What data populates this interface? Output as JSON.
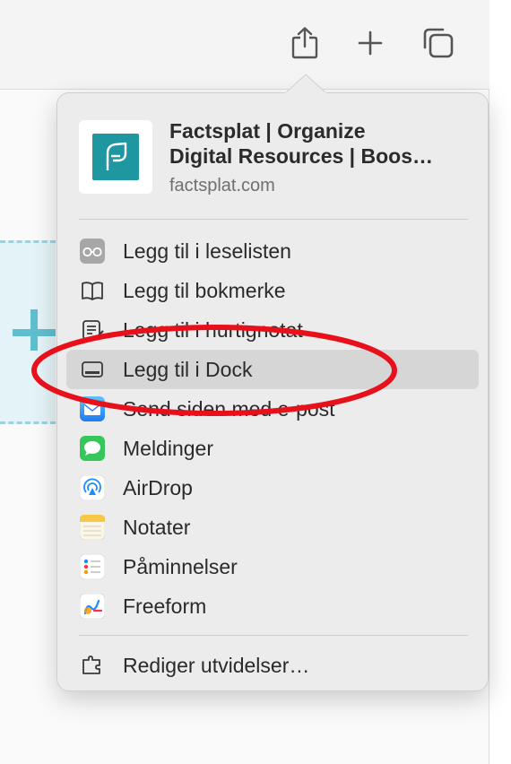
{
  "toolbar": {
    "share_icon": "share-icon",
    "new_tab_icon": "plus-icon",
    "tab_overview_icon": "tabs-overview-icon"
  },
  "share_sheet": {
    "site_title_line1": "Factsplat | Organize",
    "site_title_line2": "Digital Resources | Boos…",
    "site_url": "factsplat.com",
    "items": [
      {
        "label": "Legg til i leselisten",
        "icon": "glasses-icon"
      },
      {
        "label": "Legg til bokmerke",
        "icon": "book-icon"
      },
      {
        "label": "Legg til i hurtignotat",
        "icon": "quick-note-icon"
      },
      {
        "label": "Legg til i Dock",
        "icon": "dock-icon",
        "highlighted": true
      },
      {
        "label": "Send siden med e-post",
        "icon": "mail-icon"
      },
      {
        "label": "Meldinger",
        "icon": "messages-icon"
      },
      {
        "label": "AirDrop",
        "icon": "airdrop-icon"
      },
      {
        "label": "Notater",
        "icon": "notes-icon"
      },
      {
        "label": "Påminnelser",
        "icon": "reminders-icon"
      },
      {
        "label": "Freeform",
        "icon": "freeform-icon"
      }
    ],
    "edit_extensions": {
      "label": "Rediger utvidelser…",
      "icon": "extensions-icon"
    }
  },
  "colors": {
    "annotation": "#e8101a",
    "favicon": "#1f97a1",
    "highlight": "#d6d6d6"
  }
}
